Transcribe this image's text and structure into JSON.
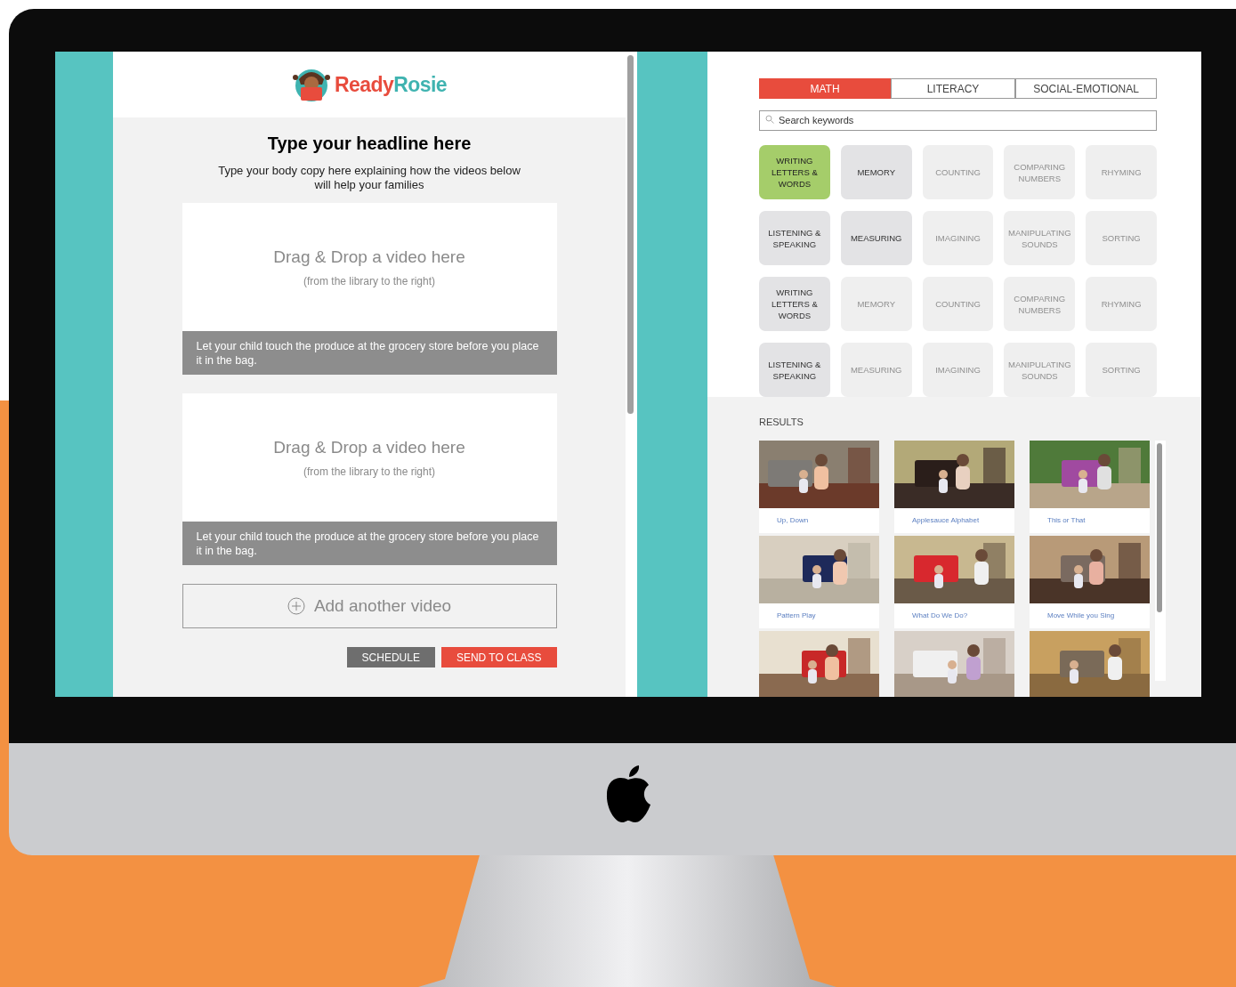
{
  "logo": {
    "first": "Ready",
    "second": "Rosie"
  },
  "editor": {
    "headline": "Type your headline here",
    "body": "Type your body copy here explaining how the videos below will help your families",
    "slots": [
      {
        "title": "Drag & Drop a video here",
        "hint": "(from the library to the right)",
        "caption": "Let your child touch the produce at the grocery store before you place it in the bag."
      },
      {
        "title": "Drag & Drop a video here",
        "hint": "(from the library to the right)",
        "caption": "Let your child touch the produce at the grocery store before you place it in the bag."
      }
    ],
    "add_button": "Add another video",
    "buttons": [
      {
        "label": "SCHEDULE",
        "kind": "secondary"
      },
      {
        "label": "SEND TO CLASS",
        "kind": "primary"
      }
    ]
  },
  "library": {
    "tabs": [
      {
        "label": "MATH",
        "selected": true
      },
      {
        "label": "LITERACY",
        "selected": false
      },
      {
        "label": "SOCIAL-EMOTIONAL",
        "selected": false
      }
    ],
    "search": {
      "placeholder": "Search keywords"
    },
    "topics": [
      {
        "label": "WRITING LETTERS & WORDS",
        "selected": true,
        "highlighted": false
      },
      {
        "label": "MEMORY",
        "selected": false,
        "highlighted": true
      },
      {
        "label": "COUNTING",
        "selected": false,
        "highlighted": false
      },
      {
        "label": "COMPARING NUMBERS",
        "selected": false,
        "highlighted": false
      },
      {
        "label": "RHYMING",
        "selected": false,
        "highlighted": false
      },
      {
        "label": "LISTENING & SPEAKING",
        "selected": false,
        "highlighted": true
      },
      {
        "label": "MEASURING",
        "selected": false,
        "highlighted": true
      },
      {
        "label": "IMAGINING",
        "selected": false,
        "highlighted": false
      },
      {
        "label": "MANIPULATING SOUNDS",
        "selected": false,
        "highlighted": false
      },
      {
        "label": "SORTING",
        "selected": false,
        "highlighted": false
      },
      {
        "label": "WRITING LETTERS & WORDS",
        "selected": false,
        "highlighted": true
      },
      {
        "label": "MEMORY",
        "selected": false,
        "highlighted": false
      },
      {
        "label": "COUNTING",
        "selected": false,
        "highlighted": false
      },
      {
        "label": "COMPARING NUMBERS",
        "selected": false,
        "highlighted": false
      },
      {
        "label": "RHYMING",
        "selected": false,
        "highlighted": false
      },
      {
        "label": "LISTENING & SPEAKING",
        "selected": false,
        "highlighted": true
      },
      {
        "label": "MEASURING",
        "selected": false,
        "highlighted": false
      },
      {
        "label": "IMAGINING",
        "selected": false,
        "highlighted": false
      },
      {
        "label": "MANIPULATING SOUNDS",
        "selected": false,
        "highlighted": false
      },
      {
        "label": "SORTING",
        "selected": false,
        "highlighted": false
      }
    ],
    "results_label": "RESULTS",
    "results": [
      {
        "title": "Up, Down"
      },
      {
        "title": "Applesauce Alphabet"
      },
      {
        "title": "This or That"
      },
      {
        "title": "Pattern Play"
      },
      {
        "title": "What Do We Do?"
      },
      {
        "title": "Move While you Sing"
      },
      {
        "kind": "picture"
      },
      {
        "kind": "picture"
      },
      {
        "kind": "picture"
      }
    ]
  }
}
